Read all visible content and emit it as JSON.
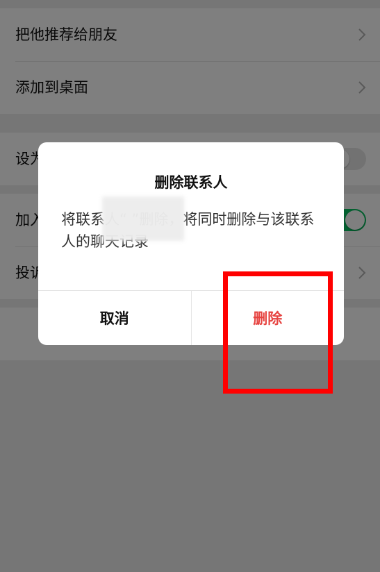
{
  "settings": {
    "items": [
      {
        "label": "把他推荐给朋友"
      },
      {
        "label": "添加到桌面"
      },
      {
        "label": "设为"
      },
      {
        "label": "加入"
      },
      {
        "label": "投诉"
      }
    ]
  },
  "dialog": {
    "title": "删除联系人",
    "message": "将联系人“ ”删除，将同时删除与该联系人的聊天记录",
    "cancel_label": "取消",
    "confirm_label": "删除"
  },
  "colors": {
    "confirm": "#e64340",
    "toggle_on": "#07c160",
    "highlight": "#ff0000"
  },
  "icons": {
    "chevron": "chevron-right-icon"
  }
}
